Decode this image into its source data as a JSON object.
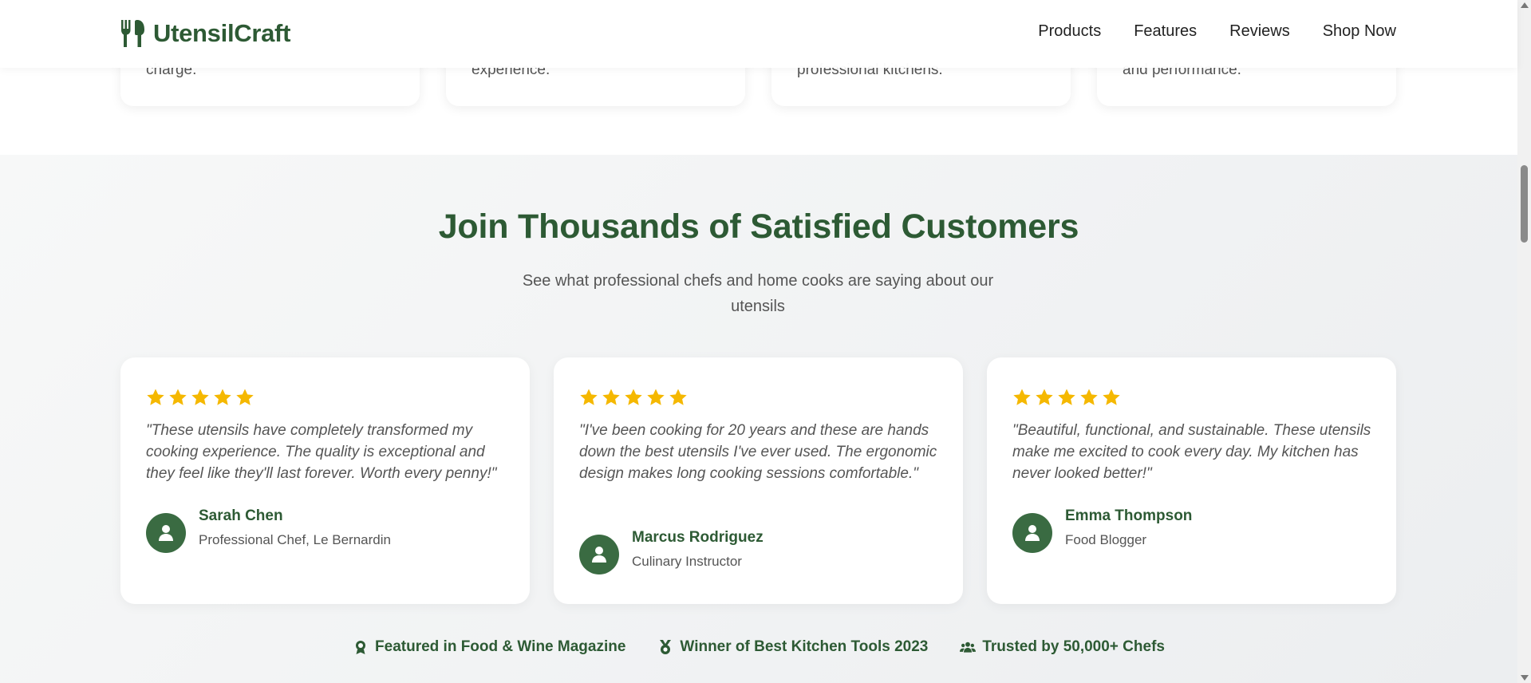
{
  "header": {
    "brand": "UtensilCraft",
    "nav": [
      "Products",
      "Features",
      "Reviews",
      "Shop Now"
    ]
  },
  "features": {
    "card_texts": [
      "charge.",
      "experience.",
      "professional kitchens.",
      "and performance."
    ]
  },
  "testimonials": {
    "title": "Join Thousands of Satisfied Customers",
    "subtitle": "See what professional chefs and home cooks are saying about our utensils",
    "reviews": [
      {
        "rating": 5,
        "quote": "\"These utensils have completely transformed my cooking experience. The quality is exceptional and they feel like they'll last forever. Worth every penny!\"",
        "name": "Sarah Chen",
        "role": "Professional Chef, Le Bernardin"
      },
      {
        "rating": 5,
        "quote": "\"I've been cooking for 20 years and these are hands down the best utensils I've ever used. The ergonomic design makes long cooking sessions comfortable.\"",
        "name": "Marcus Rodriguez",
        "role": "Culinary Instructor"
      },
      {
        "rating": 5,
        "quote": "\"Beautiful, functional, and sustainable. These utensils make me excited to cook every day. My kitchen has never looked better!\"",
        "name": "Emma Thompson",
        "role": "Food Blogger"
      }
    ],
    "badges": [
      {
        "icon": "award-icon",
        "label": "Featured in Food & Wine Magazine"
      },
      {
        "icon": "medal-icon",
        "label": "Winner of Best Kitchen Tools 2023"
      },
      {
        "icon": "users-icon",
        "label": "Trusted by 50,000+ Chefs"
      }
    ]
  },
  "colors": {
    "brand_green": "#2d5a34",
    "avatar_green": "#3a6b42",
    "star_gold": "#f5b800"
  }
}
